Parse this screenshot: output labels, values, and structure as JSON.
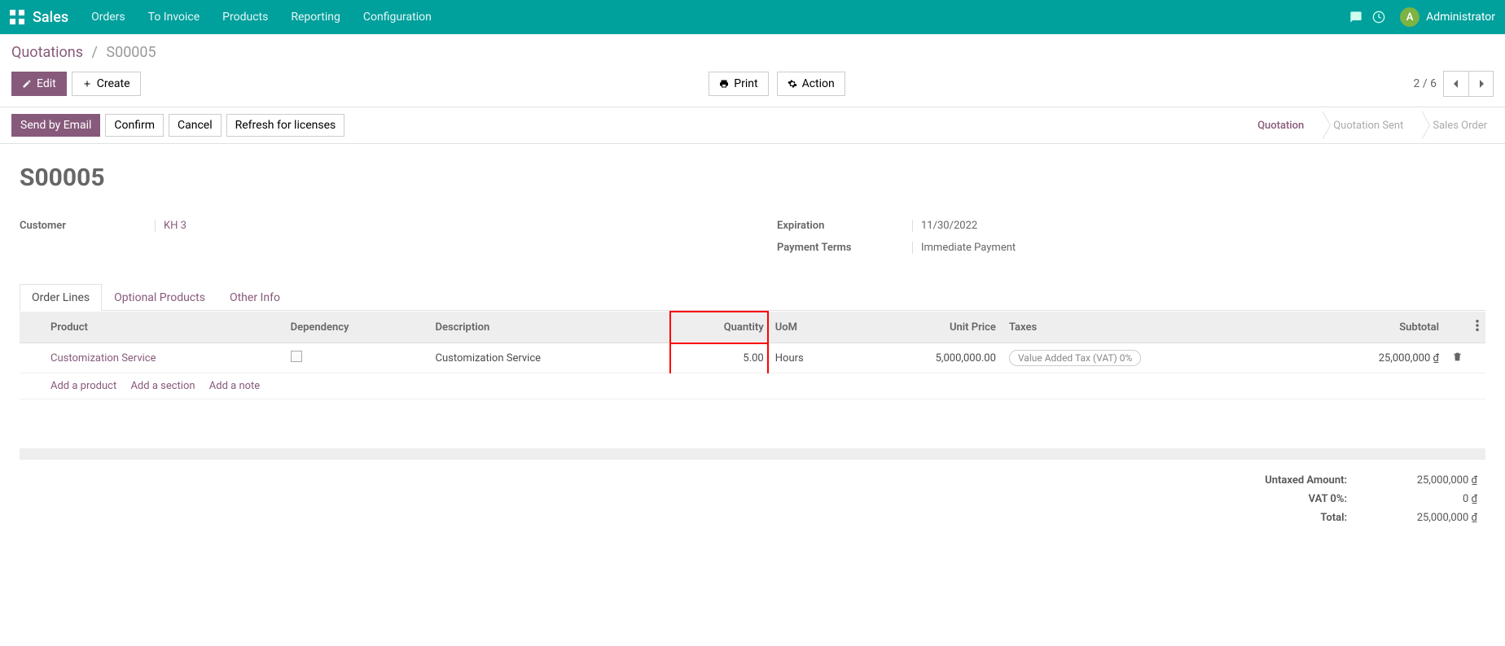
{
  "navbar": {
    "brand": "Sales",
    "links": [
      "Orders",
      "To Invoice",
      "Products",
      "Reporting",
      "Configuration"
    ],
    "avatar_letter": "A",
    "username": "Administrator"
  },
  "breadcrumb": {
    "root": "Quotations",
    "leaf": "S00005"
  },
  "buttons": {
    "edit": "Edit",
    "create": "Create",
    "print": "Print",
    "action": "Action",
    "send_email": "Send by Email",
    "confirm": "Confirm",
    "cancel": "Cancel",
    "refresh": "Refresh for licenses"
  },
  "pager": {
    "text": "2 / 6"
  },
  "status_steps": [
    "Quotation",
    "Quotation Sent",
    "Sales Order"
  ],
  "status_active_index": 0,
  "form": {
    "title": "S00005",
    "customer_label": "Customer",
    "customer_value": "KH 3",
    "expiration_label": "Expiration",
    "expiration_value": "11/30/2022",
    "payment_terms_label": "Payment Terms",
    "payment_terms_value": "Immediate Payment"
  },
  "tabs": [
    "Order Lines",
    "Optional Products",
    "Other Info"
  ],
  "active_tab_index": 0,
  "table": {
    "headers": {
      "product": "Product",
      "dependency": "Dependency",
      "description": "Description",
      "quantity": "Quantity",
      "uom": "UoM",
      "unit_price": "Unit Price",
      "taxes": "Taxes",
      "subtotal": "Subtotal"
    },
    "rows": [
      {
        "product": "Customization Service",
        "dependency": "",
        "description": "Customization Service",
        "quantity": "5.00",
        "uom": "Hours",
        "unit_price": "5,000,000.00",
        "taxes": "Value Added Tax (VAT) 0%",
        "subtotal": "25,000,000 ₫"
      }
    ],
    "add_product": "Add a product",
    "add_section": "Add a section",
    "add_note": "Add a note"
  },
  "totals": {
    "untaxed_label": "Untaxed Amount:",
    "untaxed_value": "25,000,000 ₫",
    "vat_label": "VAT 0%:",
    "vat_value": "0 ₫",
    "total_label": "Total:",
    "total_value": "25,000,000 ₫"
  }
}
